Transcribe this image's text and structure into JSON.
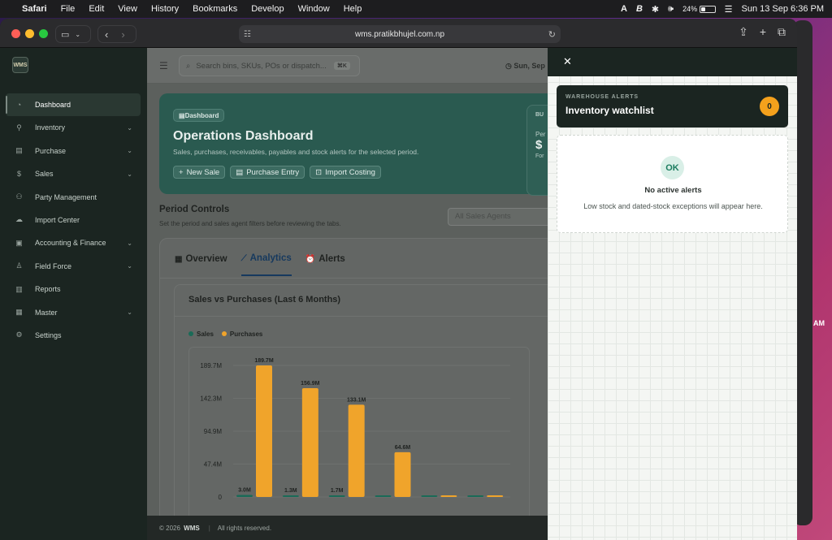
{
  "menubar": {
    "items": [
      "Safari",
      "File",
      "Edit",
      "View",
      "History",
      "Bookmarks",
      "Develop",
      "Window",
      "Help"
    ],
    "battery": "24%",
    "clock": "Sun 13 Sep  6:36 PM",
    "bg_time_am": "AM"
  },
  "browser": {
    "url": "wms.pratikbhujel.com.np"
  },
  "sidebar": {
    "logo_text": "WMS",
    "items": [
      {
        "label": "Dashboard",
        "icon": "gauge-icon",
        "glyph": "◔",
        "chevron": false,
        "active": true
      },
      {
        "label": "Inventory",
        "icon": "wrench-icon",
        "glyph": "⚲",
        "chevron": true
      },
      {
        "label": "Purchase",
        "icon": "store-icon",
        "glyph": "▤",
        "chevron": true
      },
      {
        "label": "Sales",
        "icon": "dollar-icon",
        "glyph": "$",
        "chevron": true
      },
      {
        "label": "Party Management",
        "icon": "users-icon",
        "glyph": "⚇",
        "chevron": false
      },
      {
        "label": "Import Center",
        "icon": "cloud-icon",
        "glyph": "☁",
        "chevron": false
      },
      {
        "label": "Accounting & Finance",
        "icon": "ledger-icon",
        "glyph": "▣",
        "chevron": true
      },
      {
        "label": "Field Force",
        "icon": "person-icon",
        "glyph": "♙",
        "chevron": true
      },
      {
        "label": "Reports",
        "icon": "bar-chart-icon",
        "glyph": "▥",
        "chevron": false
      },
      {
        "label": "Master",
        "icon": "archive-icon",
        "glyph": "▦",
        "chevron": true
      },
      {
        "label": "Settings",
        "icon": "gear-icon",
        "glyph": "⚙",
        "chevron": false
      }
    ]
  },
  "topbar": {
    "search_placeholder": "Search bins, SKUs, POs or dispatch...",
    "search_kbd": "⌘K",
    "date": "Sun, Sep"
  },
  "hero": {
    "chip": "Dashboard",
    "title": "Operations Dashboard",
    "subtitle": "Sales, purchases, receivables, payables and stock alerts for the selected period.",
    "buttons": [
      "New Sale",
      "Purchase Entry",
      "Import Costing"
    ],
    "side_card": {
      "kicker": "BU",
      "label": "Per",
      "value": "$",
      "note": "For"
    }
  },
  "period": {
    "title": "Period Controls",
    "subtitle": "Set the period and sales agent filters before reviewing the tabs.",
    "agent_placeholder": "All Sales Agents"
  },
  "tabs": [
    {
      "label": "Overview",
      "icon": "calendar-icon",
      "glyph": "▦",
      "active": false
    },
    {
      "label": "Analytics",
      "icon": "line-chart-icon",
      "glyph": "⟋",
      "active": true
    },
    {
      "label": "Alerts",
      "icon": "alarm-icon",
      "glyph": "⏰",
      "active": false
    }
  ],
  "chart_data": {
    "type": "bar",
    "title": "Sales vs Purchases (Last 6 Months)",
    "categories": [
      "",
      "",
      "",
      "",
      "",
      ""
    ],
    "series": [
      {
        "name": "Sales",
        "color": "#1a6b57",
        "values": [
          3.0,
          1.3,
          1.7,
          0,
          0,
          0
        ]
      },
      {
        "name": "Purchases",
        "color": "#f0a42b",
        "values": [
          189.7,
          156.9,
          133.1,
          64.6,
          0,
          0
        ]
      }
    ],
    "data_labels": {
      "Sales": [
        "3.0M",
        "1.3M",
        "1.7M",
        "",
        "",
        ""
      ],
      "Purchases": [
        "189.7M",
        "156.9M",
        "133.1M",
        "64.6M",
        "",
        ""
      ]
    },
    "y_ticks": [
      "0",
      "47.4M",
      "94.9M",
      "142.3M",
      "189.7M"
    ],
    "ylim": [
      0,
      189.7
    ],
    "grid": true,
    "legend": "top-left"
  },
  "footer": {
    "copy": "© 2026",
    "brand": "WMS",
    "sep": "|",
    "rights": "All rights reserved."
  },
  "drawer": {
    "kicker": "WAREHOUSE ALERTS",
    "title": "Inventory watchlist",
    "count": "0",
    "ok": "OK",
    "empty_title": "No active alerts",
    "empty_sub": "Low stock and dated-stock exceptions will appear here."
  }
}
